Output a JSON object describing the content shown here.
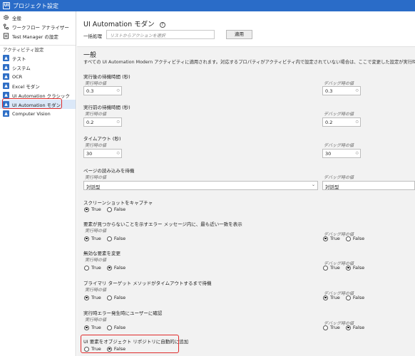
{
  "window": {
    "title": "プロジェクト設定",
    "app_icon": "UI"
  },
  "sidebar": {
    "items": [
      {
        "label": "全般",
        "icon": "gear-icon"
      },
      {
        "label": "ワークフロー アナライザー",
        "icon": "workflow-analyzer-icon"
      },
      {
        "label": "Test Manager の設定",
        "icon": "test-manager-icon"
      }
    ],
    "section_label": "アクティビティ設定",
    "activity_items": [
      {
        "label": "テスト",
        "icon": "activity-package-icon"
      },
      {
        "label": "システム",
        "icon": "activity-package-icon"
      },
      {
        "label": "OCR",
        "icon": "activity-package-icon"
      },
      {
        "label": "Excel モダン",
        "icon": "activity-package-icon"
      },
      {
        "label": "UI Automation クラシック",
        "icon": "activity-package-icon"
      },
      {
        "label": "UI Automation モダン",
        "icon": "activity-package-icon",
        "selected": true
      },
      {
        "label": "Computer Vision",
        "icon": "activity-package-icon"
      }
    ]
  },
  "header": {
    "title": "UI Automation モダン",
    "help_icon": "?",
    "batch_label": "一括処理",
    "batch_placeholder": "リストからアクションを選択",
    "apply_label": "適用"
  },
  "general": {
    "title": "一般",
    "description": "すべての UI Automation Modern アクティビティに適用されます。対応するプロパティがアクティビティ内で設定されていない場合は、ここで変更した設定が実行時に有効化されます。"
  },
  "labels": {
    "runtime": "実行時の値",
    "debug": "デバッグ時の値",
    "true": "True",
    "false": "False"
  },
  "settings": {
    "delay_after": {
      "label": "実行後の待機時間 (秒)",
      "runtime": "0.3",
      "debug": "0.3"
    },
    "delay_before": {
      "label": "実行前の待機時間 (秒)",
      "runtime": "0.2",
      "debug": "0.2"
    },
    "timeout": {
      "label": "タイムアウト (秒)",
      "runtime": "30",
      "debug": "30"
    },
    "wait_page_load": {
      "label": "ページの読み込みを待機",
      "runtime": "対話型",
      "debug": "対話型"
    },
    "screenshot": {
      "label": "スクリーンショットをキャプチャ",
      "runtime": true
    },
    "closest_match": {
      "label": "要素が見つからないことを示すエラー メッセージ内に、最も近い一致を表示",
      "runtime": true,
      "debug": true
    },
    "invalid_elements": {
      "label": "無効な要素を変更",
      "runtime": false,
      "debug": false
    },
    "primary_target": {
      "label": "プライマリ ターゲット メソッドがタイムアウトするまで待機",
      "runtime": true,
      "debug": true
    },
    "confirm_error": {
      "label": "実行時エラー発生時にユーザーに確認",
      "runtime": true,
      "debug": false
    },
    "add_to_repo": {
      "label": "UI 要素をオブジェクト リポジトリに自動的に追加",
      "runtime": false
    }
  }
}
